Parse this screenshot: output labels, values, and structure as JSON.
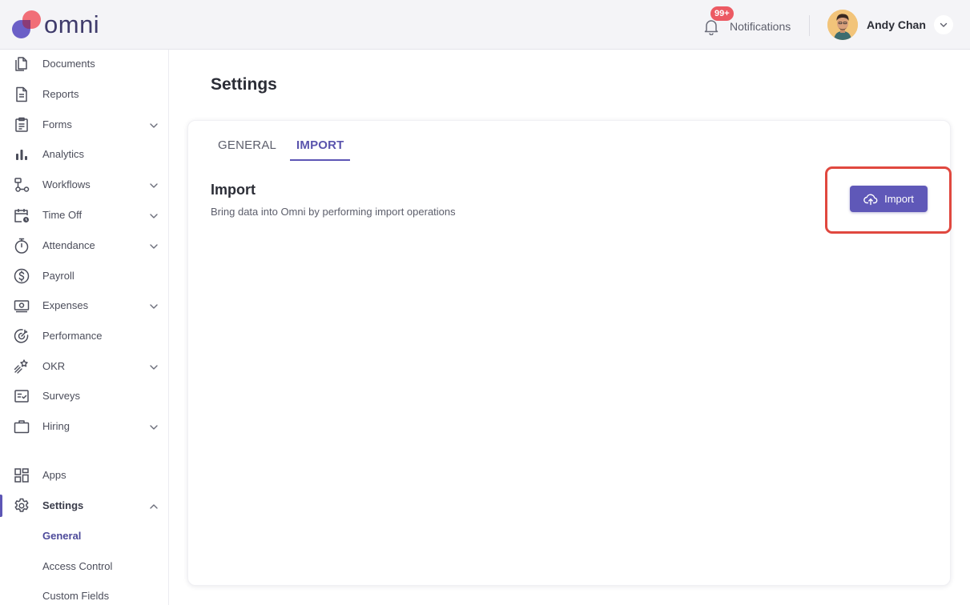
{
  "brand": {
    "name": "omni"
  },
  "header": {
    "notifications_badge": "99+",
    "notifications_label": "Notifications",
    "user_name": "Andy Chan"
  },
  "sidebar": {
    "items": [
      {
        "label": "Documents",
        "icon": "documents-icon",
        "has_chevron": false
      },
      {
        "label": "Reports",
        "icon": "reports-icon",
        "has_chevron": false
      },
      {
        "label": "Forms",
        "icon": "forms-icon",
        "has_chevron": true
      },
      {
        "label": "Analytics",
        "icon": "analytics-icon",
        "has_chevron": false
      },
      {
        "label": "Workflows",
        "icon": "workflows-icon",
        "has_chevron": true
      },
      {
        "label": "Time Off",
        "icon": "calendar-clock-icon",
        "has_chevron": true
      },
      {
        "label": "Attendance",
        "icon": "stopwatch-icon",
        "has_chevron": true
      },
      {
        "label": "Payroll",
        "icon": "dollar-circle-icon",
        "has_chevron": false
      },
      {
        "label": "Expenses",
        "icon": "money-bill-icon",
        "has_chevron": true
      },
      {
        "label": "Performance",
        "icon": "target-icon",
        "has_chevron": false
      },
      {
        "label": "OKR",
        "icon": "rocket-stars-icon",
        "has_chevron": true
      },
      {
        "label": "Surveys",
        "icon": "checklist-icon",
        "has_chevron": false
      },
      {
        "label": "Hiring",
        "icon": "briefcase-icon",
        "has_chevron": true
      }
    ],
    "apps_label": "Apps",
    "settings_label": "Settings",
    "settings_sub": [
      "General",
      "Access Control",
      "Custom Fields"
    ]
  },
  "main": {
    "page_title": "Settings",
    "tabs": [
      "GENERAL",
      "IMPORT"
    ],
    "active_tab": "IMPORT",
    "section_title": "Import",
    "section_description": "Bring data into Omni by performing import operations",
    "import_button_label": "Import"
  },
  "colors": {
    "accent": "#5f58b8",
    "highlight": "#e0483f",
    "badge": "#ec5a63"
  }
}
